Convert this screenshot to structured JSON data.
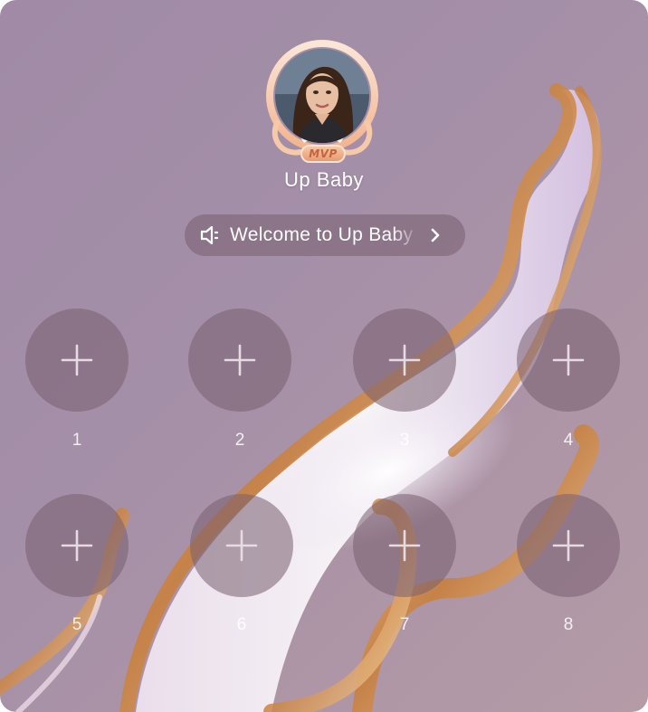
{
  "host": {
    "name": "Up Baby",
    "badge": "MVP",
    "avatar_icon": "host-avatar"
  },
  "notice": {
    "text": "Welcome to Up Baby",
    "icon": "speaker-icon",
    "chevron": "chevron-right-icon"
  },
  "seats": [
    {
      "label": "1"
    },
    {
      "label": "2"
    },
    {
      "label": "3"
    },
    {
      "label": "4"
    },
    {
      "label": "5"
    },
    {
      "label": "6"
    },
    {
      "label": "7"
    },
    {
      "label": "8"
    }
  ],
  "colors": {
    "background": "#a48fa8",
    "seat": "#7a5f70",
    "badge": "#e79a74",
    "swirl_gold": "#d99a52"
  }
}
